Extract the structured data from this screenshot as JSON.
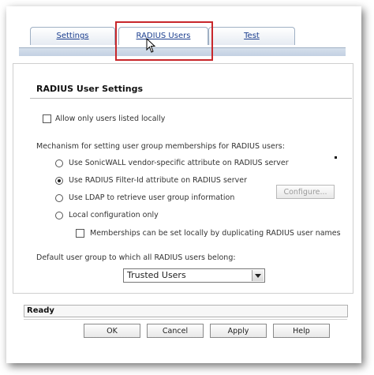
{
  "tabs": [
    {
      "label": "Settings",
      "active": false
    },
    {
      "label": "RADIUS Users",
      "active": true
    },
    {
      "label": "Test",
      "active": false
    }
  ],
  "section": {
    "title": "RADIUS User Settings",
    "allow_local_label": "Allow only users listed locally",
    "mechanism_label": "Mechanism for setting user group memberships for RADIUS users:",
    "options": [
      {
        "label": "Use SonicWALL vendor-specific attribute on RADIUS server",
        "selected": false
      },
      {
        "label": "Use RADIUS Filter-Id attribute on RADIUS server",
        "selected": true
      },
      {
        "label": "Use LDAP to retrieve user group information",
        "selected": false
      },
      {
        "label": "Local configuration only",
        "selected": false
      }
    ],
    "configure_button": "Configure...",
    "memberships_label": "Memberships can be set locally by duplicating RADIUS user names",
    "default_group_label": "Default user group to which all RADIUS users belong:",
    "default_group_value": "Trusted Users"
  },
  "status": {
    "text": "Ready"
  },
  "buttons": {
    "ok": "OK",
    "cancel": "Cancel",
    "apply": "Apply",
    "help": "Help"
  },
  "colors": {
    "highlight": "#c8272b",
    "tab_link": "#1c3f8f"
  }
}
